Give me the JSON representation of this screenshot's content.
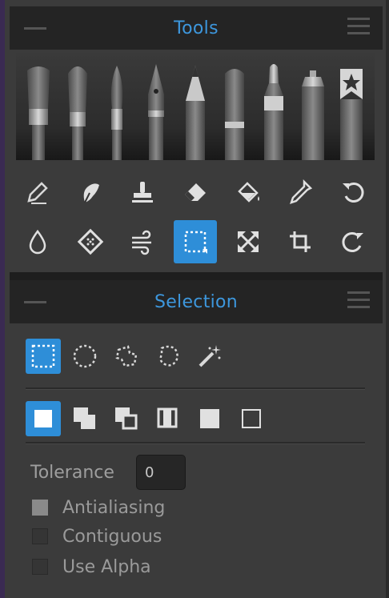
{
  "tools_panel": {
    "title": "Tools",
    "brushes": [
      "flat-brush-icon",
      "round-brush-icon",
      "fine-brush-icon",
      "ink-pen-icon",
      "pencil-icon",
      "pastel-icon",
      "marker-icon",
      "airbrush-icon",
      "stencil-brush-icon"
    ],
    "row1": [
      "eraser-pencil-icon",
      "smudge-icon",
      "stamp-icon",
      "eraser-icon",
      "fill-bucket-icon",
      "eyedropper-icon",
      "undo-icon"
    ],
    "row2": [
      "blur-drop-icon",
      "texture-icon",
      "wind-icon",
      "rect-selection-icon",
      "transform-icon",
      "crop-icon",
      "redo-icon"
    ],
    "active_tool": "rect-selection-icon"
  },
  "selection_panel": {
    "title": "Selection",
    "shapes": [
      "rect-select-icon",
      "ellipse-select-icon",
      "lasso-select-icon",
      "freehand-select-icon",
      "magic-wand-icon"
    ],
    "modes": [
      "replace-mode-icon",
      "add-mode-icon",
      "subtract-mode-icon",
      "intersect-mode-icon",
      "fill-selection-icon",
      "empty-selection-icon"
    ],
    "tolerance_label": "Tolerance",
    "tolerance_value": "0",
    "options": [
      {
        "label": "Antialiasing",
        "checked": true
      },
      {
        "label": "Contiguous",
        "checked": false
      },
      {
        "label": "Use Alpha",
        "checked": false
      }
    ]
  },
  "colors": {
    "accent": "#2e8ed8",
    "title": "#3d97dd"
  }
}
